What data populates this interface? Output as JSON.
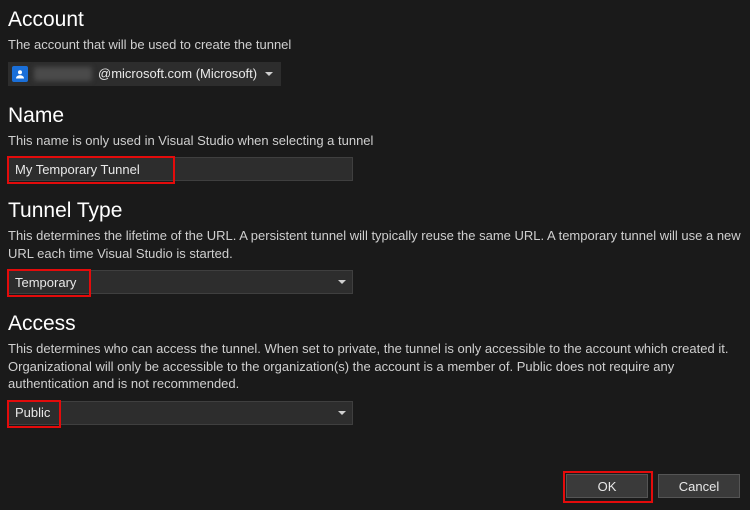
{
  "account": {
    "heading": "Account",
    "description": "The account that will be used to create the tunnel",
    "value_suffix": "@microsoft.com (Microsoft)"
  },
  "name": {
    "heading": "Name",
    "description": "This name is only used in Visual Studio when selecting a tunnel",
    "value": "My Temporary Tunnel"
  },
  "tunnel_type": {
    "heading": "Tunnel Type",
    "description": "This determines the lifetime of the URL. A persistent tunnel will typically reuse the same URL. A temporary tunnel will use a new URL each time Visual Studio is started.",
    "value": "Temporary"
  },
  "access": {
    "heading": "Access",
    "description": "This determines who can access the tunnel. When set to private, the tunnel is only accessible to the account which created it. Organizational will only be accessible to the organization(s) the account is a member of. Public does not require any authentication and is not recommended.",
    "value": "Public"
  },
  "buttons": {
    "ok": "OK",
    "cancel": "Cancel"
  }
}
